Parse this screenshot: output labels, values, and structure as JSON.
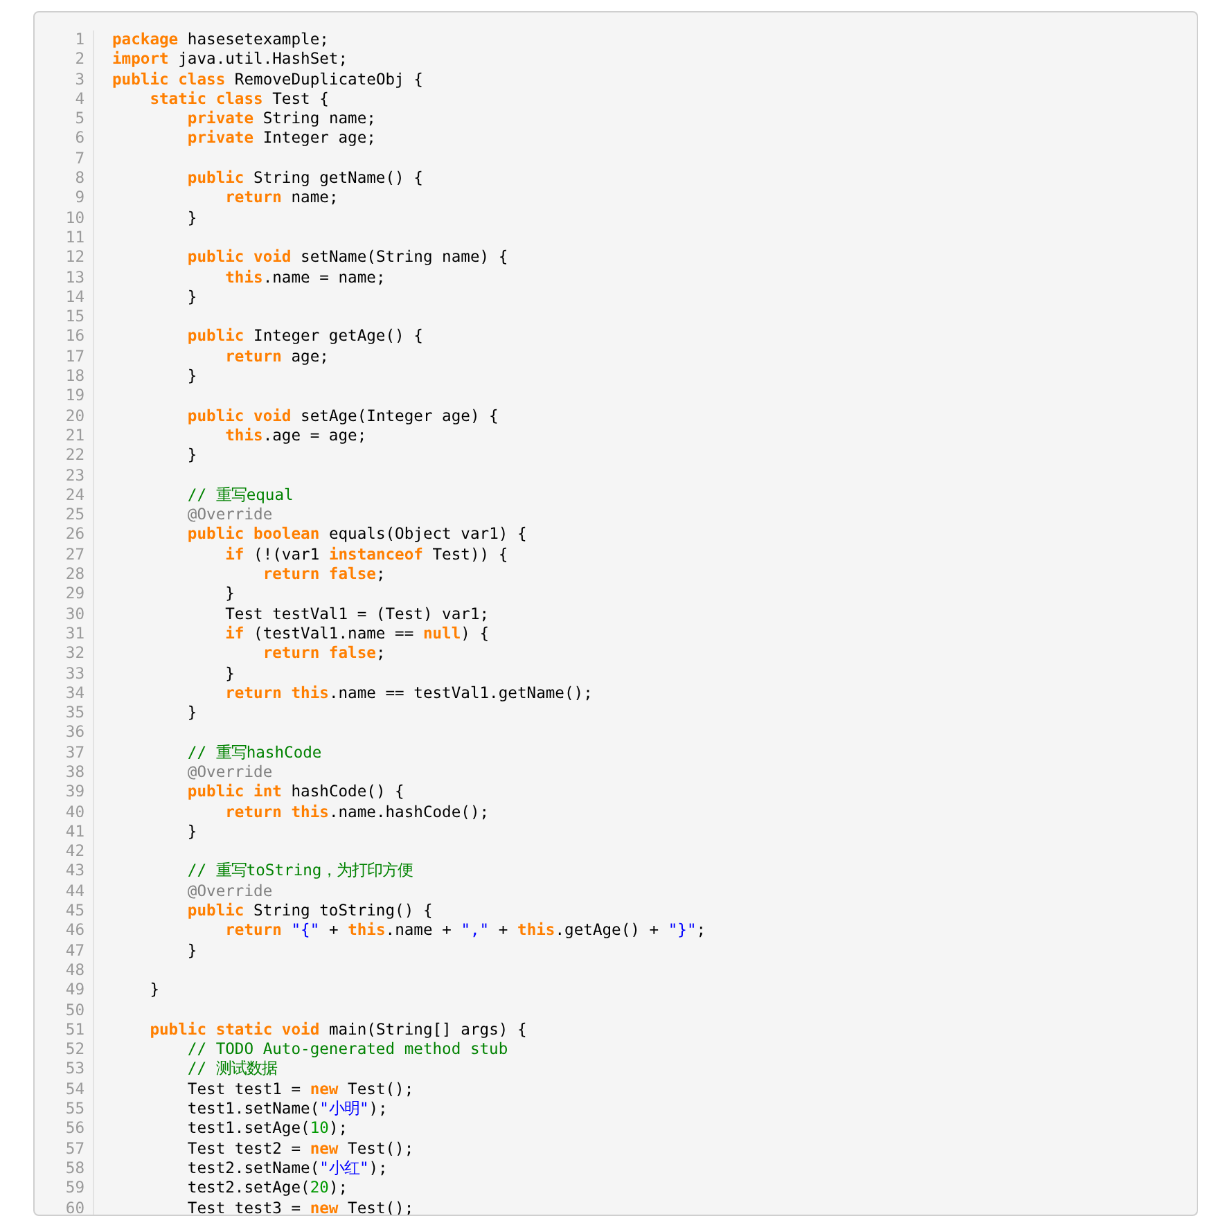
{
  "code_lines": [
    {
      "number": "1",
      "segments": [
        {
          "kind": "keyword",
          "text": "package"
        },
        {
          "kind": "plain",
          "text": " hasesetexample;"
        }
      ]
    },
    {
      "number": "2",
      "segments": [
        {
          "kind": "keyword",
          "text": "import"
        },
        {
          "kind": "plain",
          "text": " java.util.HashSet;"
        }
      ]
    },
    {
      "number": "3",
      "segments": [
        {
          "kind": "keyword",
          "text": "public class"
        },
        {
          "kind": "plain",
          "text": " RemoveDuplicateObj {"
        }
      ]
    },
    {
      "number": "4",
      "segments": [
        {
          "kind": "keyword",
          "text": "    static class"
        },
        {
          "kind": "plain",
          "text": " Test {"
        }
      ]
    },
    {
      "number": "5",
      "segments": [
        {
          "kind": "keyword",
          "text": "        private"
        },
        {
          "kind": "plain",
          "text": " String name;"
        }
      ]
    },
    {
      "number": "6",
      "segments": [
        {
          "kind": "keyword",
          "text": "        private"
        },
        {
          "kind": "plain",
          "text": " Integer age;"
        }
      ]
    },
    {
      "number": "7"
    },
    {
      "number": "8",
      "segments": [
        {
          "kind": "keyword",
          "text": "        public"
        },
        {
          "kind": "plain",
          "text": " String getName() {"
        }
      ]
    },
    {
      "number": "9",
      "segments": [
        {
          "kind": "keyword",
          "text": "            return"
        },
        {
          "kind": "plain",
          "text": " name;"
        }
      ]
    },
    {
      "number": "10",
      "segments": [
        {
          "kind": "plain",
          "text": "        }"
        }
      ]
    },
    {
      "number": "11"
    },
    {
      "number": "12",
      "segments": [
        {
          "kind": "keyword",
          "text": "        public void"
        },
        {
          "kind": "plain",
          "text": " setName(String name) {"
        }
      ]
    },
    {
      "number": "13",
      "segments": [
        {
          "kind": "keyword",
          "text": "            this"
        },
        {
          "kind": "plain",
          "text": ".name = name;"
        }
      ]
    },
    {
      "number": "14",
      "segments": [
        {
          "kind": "plain",
          "text": "        }"
        }
      ]
    },
    {
      "number": "15"
    },
    {
      "number": "16",
      "segments": [
        {
          "kind": "keyword",
          "text": "        public"
        },
        {
          "kind": "plain",
          "text": " Integer getAge() {"
        }
      ]
    },
    {
      "number": "17",
      "segments": [
        {
          "kind": "keyword",
          "text": "            return"
        },
        {
          "kind": "plain",
          "text": " age;"
        }
      ]
    },
    {
      "number": "18",
      "segments": [
        {
          "kind": "plain",
          "text": "        }"
        }
      ]
    },
    {
      "number": "19"
    },
    {
      "number": "20",
      "segments": [
        {
          "kind": "keyword",
          "text": "        public void"
        },
        {
          "kind": "plain",
          "text": " setAge(Integer age) {"
        }
      ]
    },
    {
      "number": "21",
      "segments": [
        {
          "kind": "keyword",
          "text": "            this"
        },
        {
          "kind": "plain",
          "text": ".age = age;"
        }
      ]
    },
    {
      "number": "22",
      "segments": [
        {
          "kind": "plain",
          "text": "        }"
        }
      ]
    },
    {
      "number": "23"
    },
    {
      "number": "24",
      "segments": [
        {
          "kind": "comment",
          "text": "        // 重写equal"
        }
      ]
    },
    {
      "number": "25",
      "segments": [
        {
          "kind": "annotation",
          "text": "        @Override"
        }
      ]
    },
    {
      "number": "26",
      "segments": [
        {
          "kind": "keyword",
          "text": "        public boolean"
        },
        {
          "kind": "plain",
          "text": " equals(Object var1) {"
        }
      ]
    },
    {
      "number": "27",
      "segments": [
        {
          "kind": "keyword",
          "text": "            if"
        },
        {
          "kind": "plain",
          "text": " (!(var1 "
        },
        {
          "kind": "keyword",
          "text": "instanceof"
        },
        {
          "kind": "plain",
          "text": " Test)) {"
        }
      ]
    },
    {
      "number": "28",
      "segments": [
        {
          "kind": "keyword",
          "text": "                return false"
        },
        {
          "kind": "plain",
          "text": ";"
        }
      ]
    },
    {
      "number": "29",
      "segments": [
        {
          "kind": "plain",
          "text": "            }"
        }
      ]
    },
    {
      "number": "30",
      "segments": [
        {
          "kind": "plain",
          "text": "            Test testVal1 = (Test) var1;"
        }
      ]
    },
    {
      "number": "31",
      "segments": [
        {
          "kind": "keyword",
          "text": "            if"
        },
        {
          "kind": "plain",
          "text": " (testVal1.name == "
        },
        {
          "kind": "keyword",
          "text": "null"
        },
        {
          "kind": "plain",
          "text": ") {"
        }
      ]
    },
    {
      "number": "32",
      "segments": [
        {
          "kind": "keyword",
          "text": "                return false"
        },
        {
          "kind": "plain",
          "text": ";"
        }
      ]
    },
    {
      "number": "33",
      "segments": [
        {
          "kind": "plain",
          "text": "            }"
        }
      ]
    },
    {
      "number": "34",
      "segments": [
        {
          "kind": "keyword",
          "text": "            return this"
        },
        {
          "kind": "plain",
          "text": ".name == testVal1.getName();"
        }
      ]
    },
    {
      "number": "35",
      "segments": [
        {
          "kind": "plain",
          "text": "        }"
        }
      ]
    },
    {
      "number": "36"
    },
    {
      "number": "37",
      "segments": [
        {
          "kind": "comment",
          "text": "        // 重写hashCode"
        }
      ]
    },
    {
      "number": "38",
      "segments": [
        {
          "kind": "annotation",
          "text": "        @Override"
        }
      ]
    },
    {
      "number": "39",
      "segments": [
        {
          "kind": "keyword",
          "text": "        public int"
        },
        {
          "kind": "plain",
          "text": " hashCode() {"
        }
      ]
    },
    {
      "number": "40",
      "segments": [
        {
          "kind": "keyword",
          "text": "            return this"
        },
        {
          "kind": "plain",
          "text": ".name.hashCode();"
        }
      ]
    },
    {
      "number": "41",
      "segments": [
        {
          "kind": "plain",
          "text": "        }"
        }
      ]
    },
    {
      "number": "42"
    },
    {
      "number": "43",
      "segments": [
        {
          "kind": "comment",
          "text": "        // 重写toString，为打印方便"
        }
      ]
    },
    {
      "number": "44",
      "segments": [
        {
          "kind": "annotation",
          "text": "        @Override"
        }
      ]
    },
    {
      "number": "45",
      "segments": [
        {
          "kind": "keyword",
          "text": "        public"
        },
        {
          "kind": "plain",
          "text": " String toString() {"
        }
      ]
    },
    {
      "number": "46",
      "segments": [
        {
          "kind": "keyword",
          "text": "            return"
        },
        {
          "kind": "string",
          "text": " \"{\""
        },
        {
          "kind": "plain",
          "text": " + "
        },
        {
          "kind": "keyword",
          "text": "this"
        },
        {
          "kind": "plain",
          "text": ".name + "
        },
        {
          "kind": "string",
          "text": "\",\""
        },
        {
          "kind": "plain",
          "text": " + "
        },
        {
          "kind": "keyword",
          "text": "this"
        },
        {
          "kind": "plain",
          "text": ".getAge() + "
        },
        {
          "kind": "string",
          "text": "\"}\""
        },
        {
          "kind": "plain",
          "text": ";"
        }
      ]
    },
    {
      "number": "47",
      "segments": [
        {
          "kind": "plain",
          "text": "        }"
        }
      ]
    },
    {
      "number": "48"
    },
    {
      "number": "49",
      "segments": [
        {
          "kind": "plain",
          "text": "    }"
        }
      ]
    },
    {
      "number": "50"
    },
    {
      "number": "51",
      "segments": [
        {
          "kind": "keyword",
          "text": "    public static void"
        },
        {
          "kind": "plain",
          "text": " main(String[] args) {"
        }
      ]
    },
    {
      "number": "52",
      "segments": [
        {
          "kind": "comment",
          "text": "        // TODO Auto-generated method stub"
        }
      ]
    },
    {
      "number": "53",
      "segments": [
        {
          "kind": "comment",
          "text": "        // 测试数据"
        }
      ]
    },
    {
      "number": "54",
      "segments": [
        {
          "kind": "plain",
          "text": "        Test test1 = "
        },
        {
          "kind": "keyword",
          "text": "new"
        },
        {
          "kind": "plain",
          "text": " Test();"
        }
      ]
    },
    {
      "number": "55",
      "segments": [
        {
          "kind": "plain",
          "text": "        test1.setName("
        },
        {
          "kind": "string",
          "text": "\"小明\""
        },
        {
          "kind": "plain",
          "text": ");"
        }
      ]
    },
    {
      "number": "56",
      "segments": [
        {
          "kind": "plain",
          "text": "        test1.setAge("
        },
        {
          "kind": "number",
          "text": "10"
        },
        {
          "kind": "plain",
          "text": ");"
        }
      ]
    },
    {
      "number": "57",
      "segments": [
        {
          "kind": "plain",
          "text": "        Test test2 = "
        },
        {
          "kind": "keyword",
          "text": "new"
        },
        {
          "kind": "plain",
          "text": " Test();"
        }
      ]
    },
    {
      "number": "58",
      "segments": [
        {
          "kind": "plain",
          "text": "        test2.setName("
        },
        {
          "kind": "string",
          "text": "\"小红\""
        },
        {
          "kind": "plain",
          "text": ");"
        }
      ]
    },
    {
      "number": "59",
      "segments": [
        {
          "kind": "plain",
          "text": "        test2.setAge("
        },
        {
          "kind": "number",
          "text": "20"
        },
        {
          "kind": "plain",
          "text": ");"
        }
      ]
    },
    {
      "number": "60",
      "segments": [
        {
          "kind": "plain",
          "text": "        Test test3 = "
        },
        {
          "kind": "keyword",
          "text": "new"
        },
        {
          "kind": "plain",
          "text": " Test();"
        }
      ]
    }
  ]
}
